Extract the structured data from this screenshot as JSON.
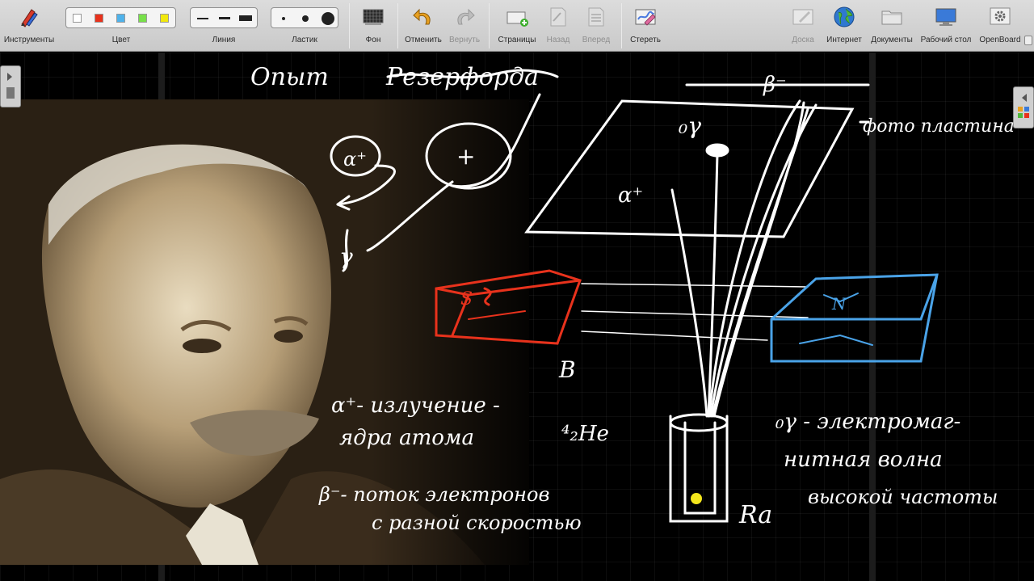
{
  "toolbar": {
    "tools": {
      "label": "Инструменты",
      "icon": "pen-tools-icon"
    },
    "color": {
      "label": "Цвет",
      "swatches": [
        "#ffffff",
        "#e8321c",
        "#4fb2ea",
        "#78e04a",
        "#f1e80e"
      ]
    },
    "line": {
      "label": "Линия"
    },
    "eraser": {
      "label": "Ластик"
    },
    "background": {
      "label": "Фон",
      "icon": "background-grid-icon"
    },
    "undo": {
      "label": "Отменить",
      "icon": "undo-icon"
    },
    "redo": {
      "label": "Вернуть",
      "icon": "redo-icon"
    },
    "pages": {
      "label": "Страницы",
      "icon": "pages-add-icon"
    },
    "back": {
      "label": "Назад",
      "icon": "page-back-icon"
    },
    "forward": {
      "label": "Вперед",
      "icon": "page-forward-icon"
    },
    "clear": {
      "label": "Стереть",
      "icon": "clear-page-icon"
    },
    "board": {
      "label": "Доска",
      "icon": "board-icon"
    },
    "internet": {
      "label": "Интернет",
      "icon": "globe-icon"
    },
    "documents": {
      "label": "Документы",
      "icon": "folder-icon"
    },
    "desktop": {
      "label": "Рабочий стол",
      "icon": "monitor-icon"
    },
    "openboard": {
      "label": "OpenBoard",
      "icon": "gear-icon"
    }
  },
  "board": {
    "title_left": "Опыт",
    "title_right": "Резерфорда",
    "photo_plate_label": "фото пластина",
    "beta_symbol": "β⁻",
    "gamma_symbol": "₀γ",
    "alpha_symbol": "α⁺",
    "magnet_south": "S",
    "magnet_north": "N",
    "field_label": "B",
    "helium_notation": "⁴₂He",
    "radium_label": "Ra",
    "alpha_note_line1": "α⁺- излучение -",
    "alpha_note_line2": "ядра атома",
    "beta_note_line1": "β⁻- поток электронов",
    "beta_note_line2": "с разной скоростью",
    "gamma_note_line1": "₀γ - электромаг-",
    "gamma_note_line2": "нитная волна",
    "gamma_note_line3": "высокой частоты",
    "circle_alpha": "α⁺",
    "circle_plus": "+",
    "gamma_small": "γ"
  },
  "colors": {
    "accent_red": "#e8321c",
    "accent_blue": "#4aa3e8",
    "radium_dot": "#f3e61c"
  }
}
